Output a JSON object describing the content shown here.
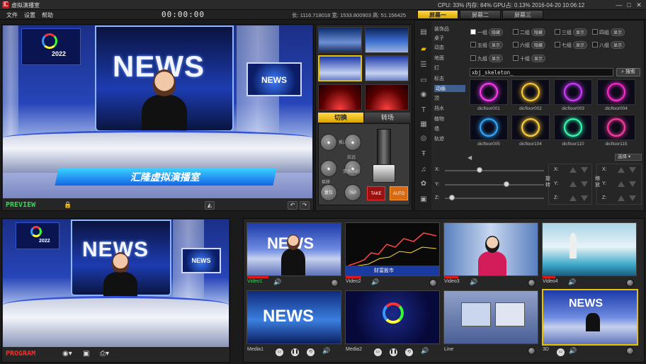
{
  "window": {
    "app_title": "虚拟演播室",
    "logo_text": "汇",
    "system_info": "CPU: 33%   内存: 84%   GPU占: 0.13%        2016-04-20 10:06:12",
    "minimize": "—",
    "maximize": "□",
    "close": "✕"
  },
  "menu": {
    "items": [
      "文件",
      "设置",
      "帮助"
    ]
  },
  "timecode": "00:00:00",
  "coords": "长: 1116.718018   宽: 1533.800903   高: 51.156425",
  "screen_tabs": [
    "屏幕一",
    "屏幕二",
    "屏幕三"
  ],
  "preview": {
    "label": "PREVIEW",
    "news_text": "NEWS",
    "banner_text": "汇隆虚拟演播室",
    "monitor_text": "NEWS",
    "logo_text": "2022"
  },
  "program": {
    "label": "PROGRAM",
    "news_text": "NEWS",
    "monitor_text": "NEWS",
    "logo_text": "2022"
  },
  "transition": {
    "tabs": [
      "切换",
      "转场"
    ],
    "buttons": [
      "推近",
      "拉远",
      "摇移",
      "变焦(AB)",
      "复位",
      "76P"
    ],
    "take": "TAKE",
    "auto": "AUTO"
  },
  "objects": {
    "categories": [
      "装饰品",
      "桌子",
      "动态",
      "地面",
      "灯",
      "标志",
      "动画",
      "顶",
      "挡水",
      "植物",
      "墙",
      "轨迹"
    ],
    "selected_category": "动画",
    "groups": [
      {
        "name": "一组",
        "tag": "隐藏",
        "checked": true
      },
      {
        "name": "二组",
        "tag": "隐藏",
        "checked": false
      },
      {
        "name": "三组",
        "tag": "显示",
        "checked": false
      },
      {
        "name": "四组",
        "tag": "显示",
        "checked": false
      },
      {
        "name": "五组",
        "tag": "显示",
        "checked": false
      },
      {
        "name": "六组",
        "tag": "隐藏",
        "checked": false
      },
      {
        "name": "七组",
        "tag": "显示",
        "checked": false
      },
      {
        "name": "八组",
        "tag": "显示",
        "checked": false
      },
      {
        "name": "九组",
        "tag": "显示",
        "checked": false
      },
      {
        "name": "十组",
        "tag": "显示",
        "checked": false
      }
    ],
    "search_value": "xbj_skeleton_",
    "search_button": "搜索",
    "effects": [
      {
        "name": "dicfloor001",
        "color": "#ff3df5"
      },
      {
        "name": "dicfloor002",
        "color": "#ffcc33"
      },
      {
        "name": "dicfloor003",
        "color": "#d13dff"
      },
      {
        "name": "dicfloor004",
        "color": "#ff2bd0"
      },
      {
        "name": "dicfloor005",
        "color": "#33a8ff"
      },
      {
        "name": "dicfloor104",
        "color": "#ffd23d"
      },
      {
        "name": "dicfloor110",
        "color": "#36ffb0"
      },
      {
        "name": "dicfloor115",
        "color": "#ff3da0"
      }
    ],
    "dropdown": "选择",
    "sliders": [
      {
        "axis": "X:",
        "value": 0.35
      },
      {
        "axis": "Y:",
        "value": 0.62
      },
      {
        "axis": "Z:",
        "value": 0.07
      }
    ],
    "rotate_label": "旋转",
    "scale_label": "缩放",
    "xyz": [
      "X:",
      "Y:",
      "Z:"
    ]
  },
  "sources": [
    {
      "label": "Video1",
      "label_color": "#34d957"
    },
    {
      "label": "Video2",
      "label_color": "#cfcfcf"
    },
    {
      "label": "Video3",
      "label_color": "#cfcfcf"
    },
    {
      "label": "Video4",
      "label_color": "#cfcfcf"
    },
    {
      "label": "Media1",
      "label_color": "#cfcfcf"
    },
    {
      "label": "Media2",
      "label_color": "#cfcfcf"
    },
    {
      "label": "Line",
      "label_color": "#cfcfcf"
    },
    {
      "label": "3D",
      "label_color": "#cfcfcf"
    }
  ],
  "thumb_news": "NEWS",
  "thumb_ticker": "财富股市"
}
